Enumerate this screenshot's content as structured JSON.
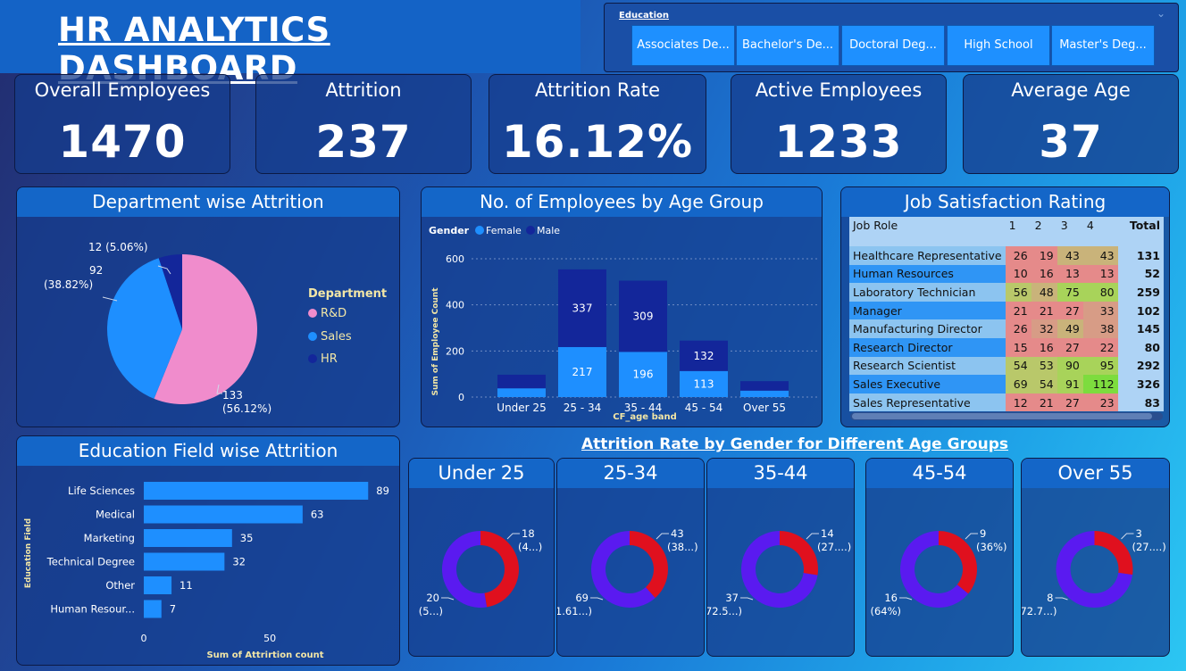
{
  "header": {
    "title": "HR ANALYTICS DASHBOARD"
  },
  "education_slicer": {
    "title": "Education",
    "options": [
      "Associates De...",
      "Bachelor's De...",
      "Doctoral Deg...",
      "High School",
      "Master's Deg..."
    ]
  },
  "kpis": [
    {
      "label": "Overall Employees",
      "value": "1470"
    },
    {
      "label": "Attrition",
      "value": "237"
    },
    {
      "label": "Attrition Rate",
      "value": "16.12%"
    },
    {
      "label": "Active Employees",
      "value": "1233"
    },
    {
      "label": "Average Age",
      "value": "37"
    }
  ],
  "dept_attrition": {
    "title": "Department wise Attrition",
    "legend_title": "Department",
    "slices": [
      {
        "name": "R&D",
        "value": 133,
        "label_value": "133",
        "label_pct": "(56.12%)",
        "color": "#f08ccc"
      },
      {
        "name": "Sales",
        "value": 92,
        "label_value": "92",
        "label_pct": "(38.82%)",
        "color": "#1e8fff"
      },
      {
        "name": "HR",
        "value": 12,
        "label_value": "12 (5.06%)",
        "label_pct": "",
        "color": "#13269a"
      }
    ]
  },
  "age_group": {
    "title": "No. of Employees by Age Group",
    "legend_title": "Gender",
    "legend": [
      {
        "name": "Female",
        "color": "#1e8fff"
      },
      {
        "name": "Male",
        "color": "#13269a"
      }
    ],
    "ylabel": "Sum of Employee Count",
    "xlabel": "CF_age band",
    "yticks": [
      "0",
      "200",
      "400",
      "600"
    ]
  },
  "job_satisfaction": {
    "title": "Job Satisfaction Rating",
    "columns": [
      "Job Role",
      "1",
      "2",
      "3",
      "4",
      "Total"
    ],
    "rows": [
      {
        "role": "Healthcare Representative",
        "v": [
          "26",
          "19",
          "43",
          "43"
        ],
        "total": "131"
      },
      {
        "role": "Human Resources",
        "v": [
          "10",
          "16",
          "13",
          "13"
        ],
        "total": "52"
      },
      {
        "role": "Laboratory Technician",
        "v": [
          "56",
          "48",
          "75",
          "80"
        ],
        "total": "259"
      },
      {
        "role": "Manager",
        "v": [
          "21",
          "21",
          "27",
          "33"
        ],
        "total": "102"
      },
      {
        "role": "Manufacturing Director",
        "v": [
          "26",
          "32",
          "49",
          "38"
        ],
        "total": "145"
      },
      {
        "role": "Research Director",
        "v": [
          "15",
          "16",
          "27",
          "22"
        ],
        "total": "80"
      },
      {
        "role": "Research Scientist",
        "v": [
          "54",
          "53",
          "90",
          "95"
        ],
        "total": "292"
      },
      {
        "role": "Sales Executive",
        "v": [
          "69",
          "54",
          "91",
          "112"
        ],
        "total": "326"
      },
      {
        "role": "Sales Representative",
        "v": [
          "12",
          "21",
          "27",
          "23"
        ],
        "total": "83"
      }
    ]
  },
  "edu_field": {
    "title": "Education Field wise Attrition",
    "ylabel": "Education Field",
    "xlabel": "Sum of Attrirtion count",
    "xticks": [
      "0",
      "50"
    ],
    "bar_color": "#1e8fff"
  },
  "gender_age": {
    "title": "Attrition Rate by Gender for Different Age Groups",
    "female_color": "#e0101e",
    "male_color": "#5a1af0",
    "groups": [
      {
        "title": "Under 25",
        "red_value": "18",
        "red_pct": "(4...)",
        "blue_value": "20",
        "blue_pct": "(5...)"
      },
      {
        "title": "25-34",
        "red_value": "43",
        "red_pct": "(38...)",
        "blue_value": "69",
        "blue_pct": "(61.61...)"
      },
      {
        "title": "35-44",
        "red_value": "14",
        "red_pct": "(27....)",
        "blue_value": "37",
        "blue_pct": "(72.5...)"
      },
      {
        "title": "45-54",
        "red_value": "9",
        "red_pct": "(36%)",
        "blue_value": "16",
        "blue_pct": "(64%)"
      },
      {
        "title": "Over 55",
        "red_value": "3",
        "red_pct": "(27....)",
        "blue_value": "8",
        "blue_pct": "(72.7...)"
      }
    ]
  },
  "chart_data": [
    {
      "type": "pie",
      "title": "Department wise Attrition",
      "categories": [
        "R&D",
        "Sales",
        "HR"
      ],
      "values": [
        133,
        92,
        12
      ]
    },
    {
      "type": "bar",
      "title": "No. of Employees by Age Group",
      "xlabel": "CF_age band",
      "ylabel": "Sum of Employee Count",
      "categories": [
        "Under 25",
        "25 - 34",
        "35 - 44",
        "45 - 54",
        "Over 55"
      ],
      "series": [
        {
          "name": "Female",
          "values": [
            38,
            217,
            196,
            113,
            28
          ]
        },
        {
          "name": "Male",
          "values": [
            59,
            337,
            309,
            132,
            41
          ]
        }
      ],
      "value_labels": {
        "Female": [
          "",
          "217",
          "196",
          "113",
          ""
        ],
        "Male": [
          "",
          "337",
          "309",
          "132",
          ""
        ]
      },
      "ylim": [
        0,
        600
      ],
      "stacked": true
    },
    {
      "type": "bar",
      "title": "Education Field wise Attrition",
      "orientation": "horizontal",
      "xlabel": "Sum of Attrirtion count",
      "ylabel": "Education Field",
      "categories": [
        "Life Sciences",
        "Medical",
        "Marketing",
        "Technical Degree",
        "Other",
        "Human Resour..."
      ],
      "values": [
        89,
        63,
        35,
        32,
        11,
        7
      ],
      "xlim": [
        0,
        100
      ]
    },
    {
      "type": "pie",
      "title": "Under 25",
      "categories": [
        "red",
        "blue"
      ],
      "values": [
        18,
        20
      ]
    },
    {
      "type": "pie",
      "title": "25-34",
      "categories": [
        "red",
        "blue"
      ],
      "values": [
        43,
        69
      ]
    },
    {
      "type": "pie",
      "title": "35-44",
      "categories": [
        "red",
        "blue"
      ],
      "values": [
        14,
        37
      ]
    },
    {
      "type": "pie",
      "title": "45-54",
      "categories": [
        "red",
        "blue"
      ],
      "values": [
        9,
        16
      ]
    },
    {
      "type": "pie",
      "title": "Over 55",
      "categories": [
        "red",
        "blue"
      ],
      "values": [
        3,
        8
      ]
    }
  ]
}
